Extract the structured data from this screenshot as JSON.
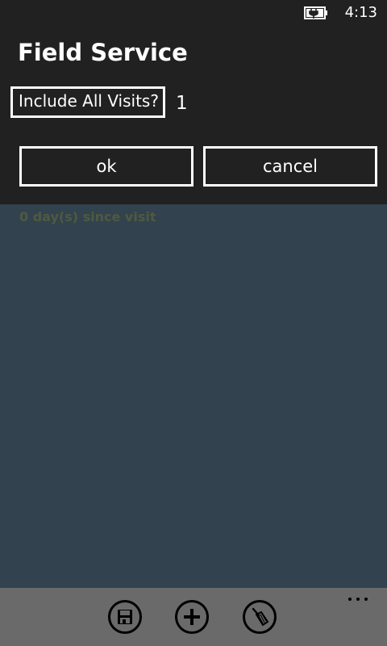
{
  "status_bar": {
    "time": "4:13",
    "battery_icon": "battery-charging-icon"
  },
  "dialog": {
    "title": "Field Service",
    "include_label": "Include All Visits?",
    "include_value": "1",
    "ok_label": "ok",
    "cancel_label": "cancel"
  },
  "main": {
    "days_since_visit": "0 day(s) since visit"
  },
  "app_bar": {
    "buttons": [
      {
        "icon": "save-icon"
      },
      {
        "icon": "add-icon"
      },
      {
        "icon": "broom-icon"
      }
    ],
    "more_icon": "ellipsis-icon"
  },
  "colors": {
    "dialog_bg": "#212121",
    "content_bg": "#32424f",
    "app_bar_bg": "#6a6a6a",
    "faded_text": "#4e5a3f"
  }
}
